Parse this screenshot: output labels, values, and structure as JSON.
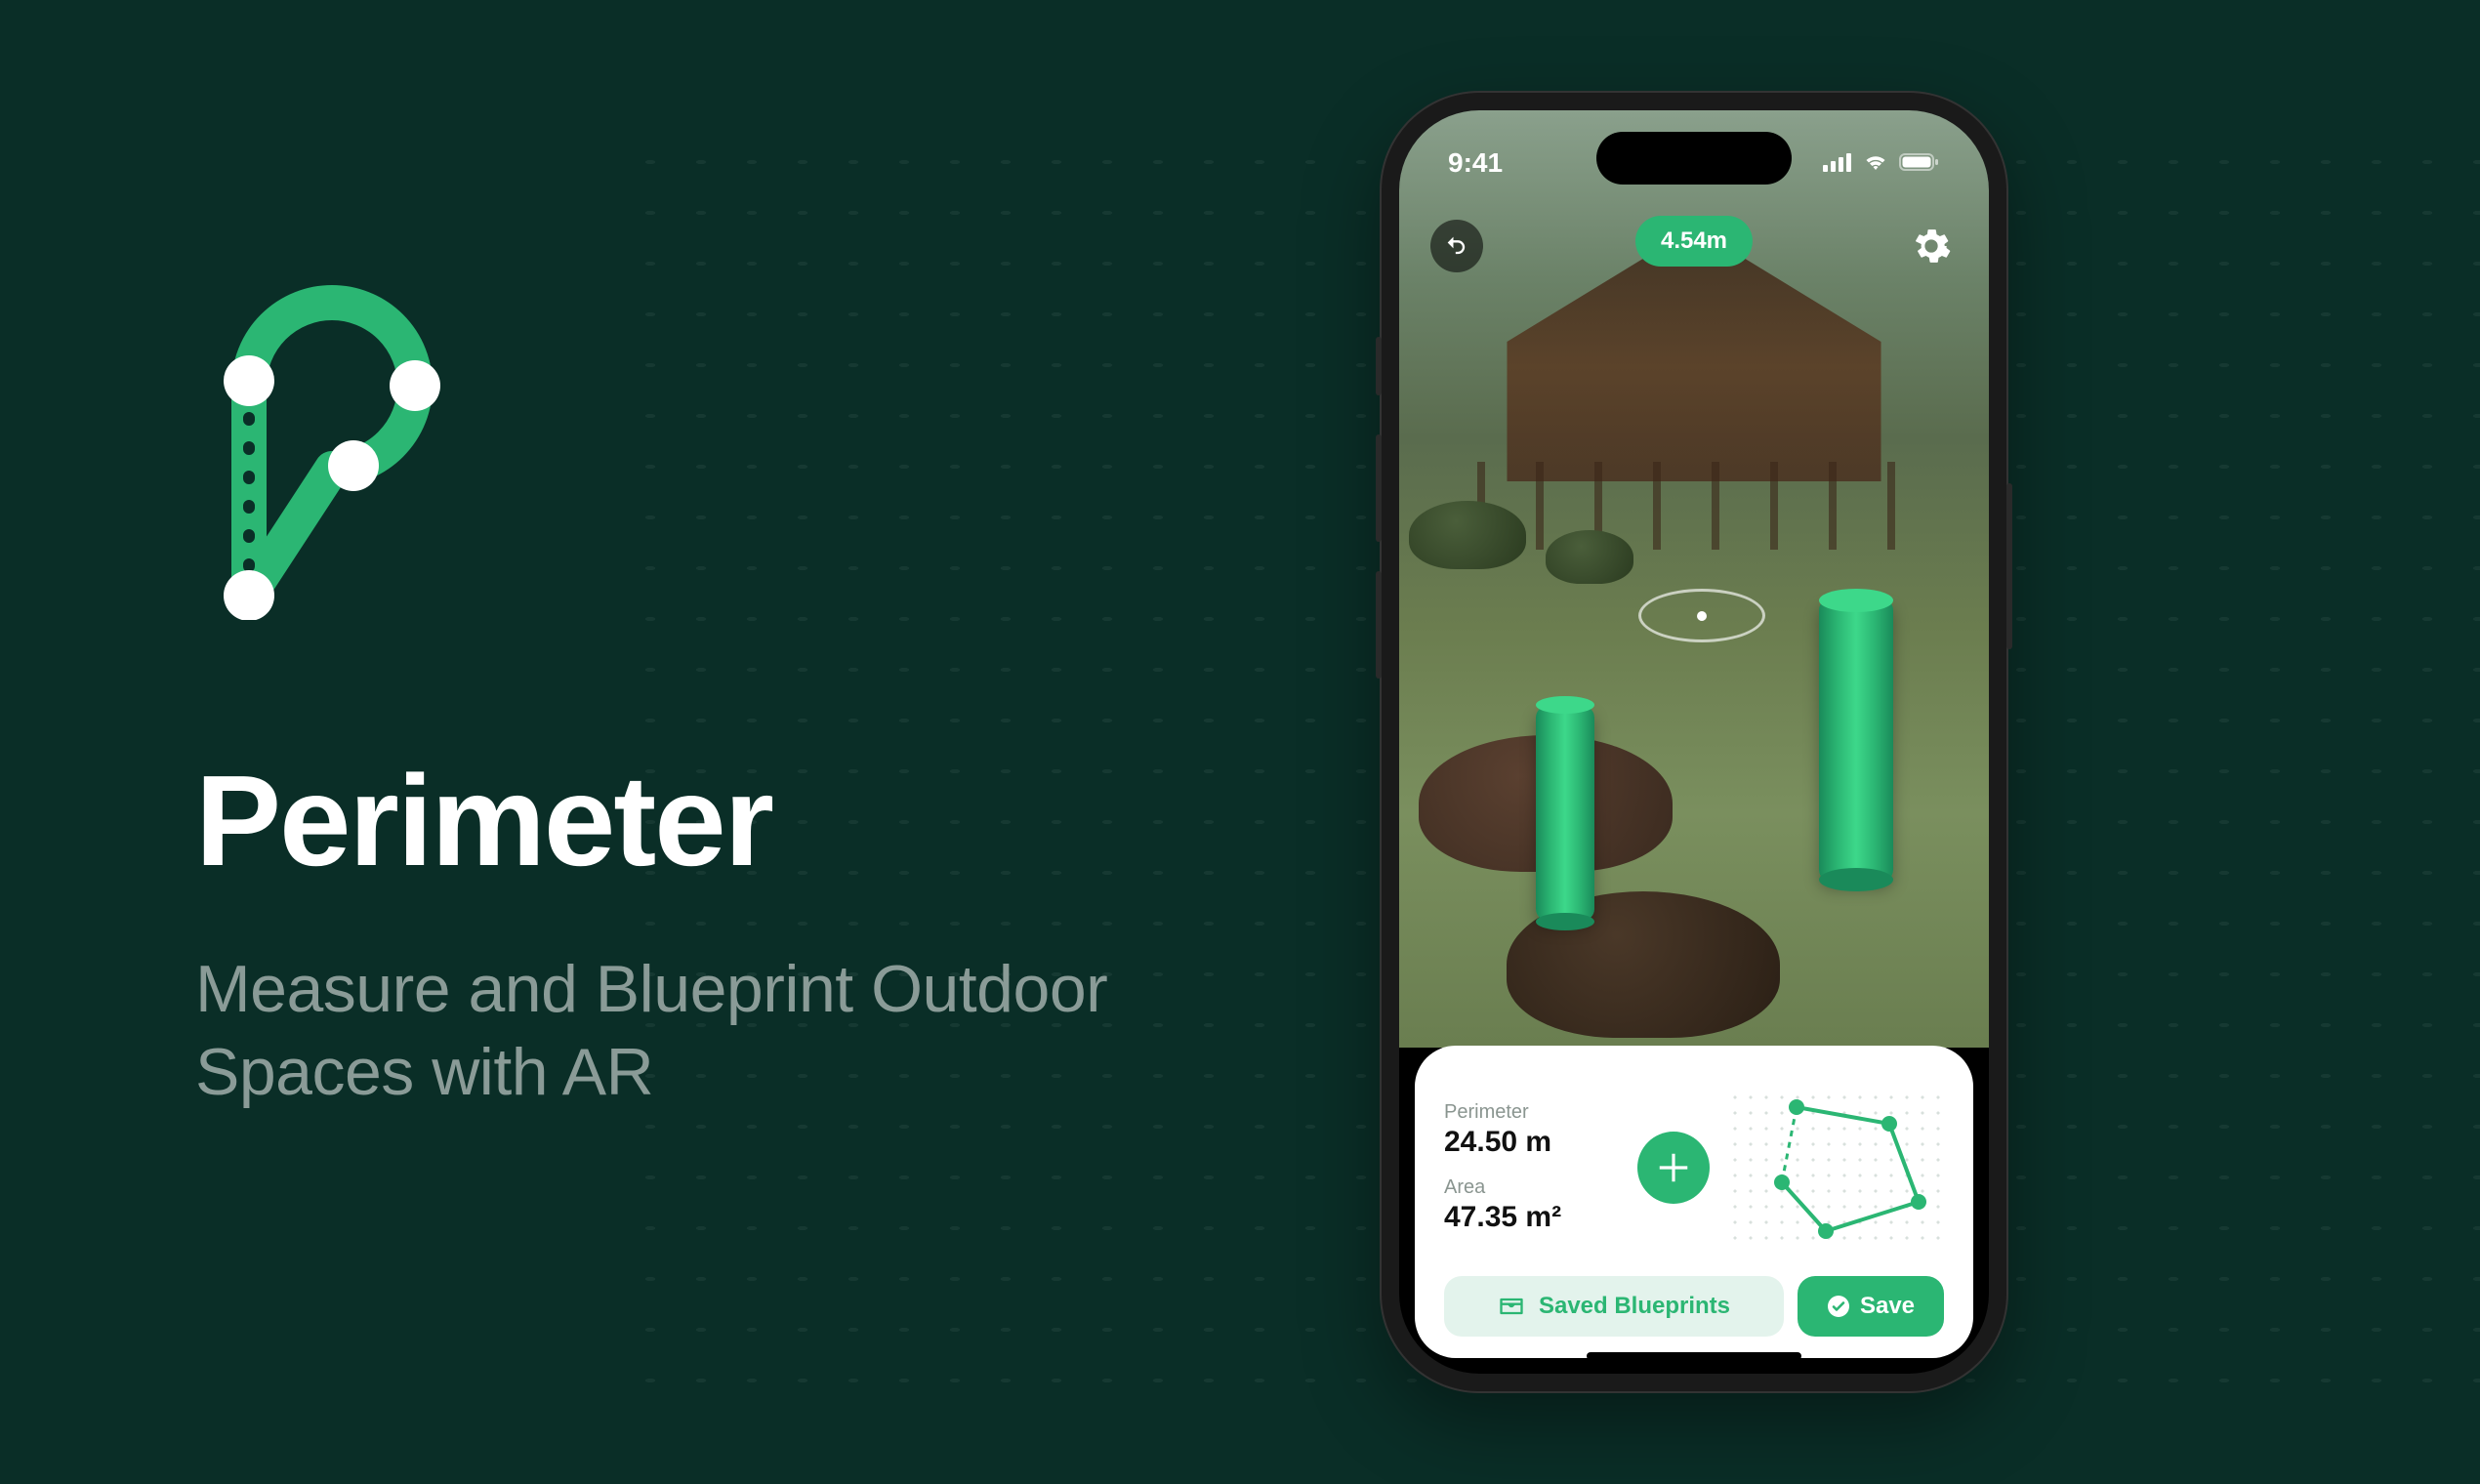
{
  "brand": {
    "name": "Perimeter",
    "tagline": "Measure and Blueprint Outdoor Spaces with AR",
    "accent": "#2bb673"
  },
  "phone": {
    "status_time": "9:41",
    "ar": {
      "current_distance": "4.54m",
      "undo_icon": "undo",
      "settings_icon": "gear"
    },
    "card": {
      "perimeter_label": "Perimeter",
      "perimeter_value": "24.50 m",
      "area_label": "Area",
      "area_value": "47.35 m²",
      "add_icon": "plus",
      "saved_label": "Saved Blueprints",
      "saved_icon": "tray",
      "save_label": "Save",
      "save_icon": "check-circle"
    }
  }
}
